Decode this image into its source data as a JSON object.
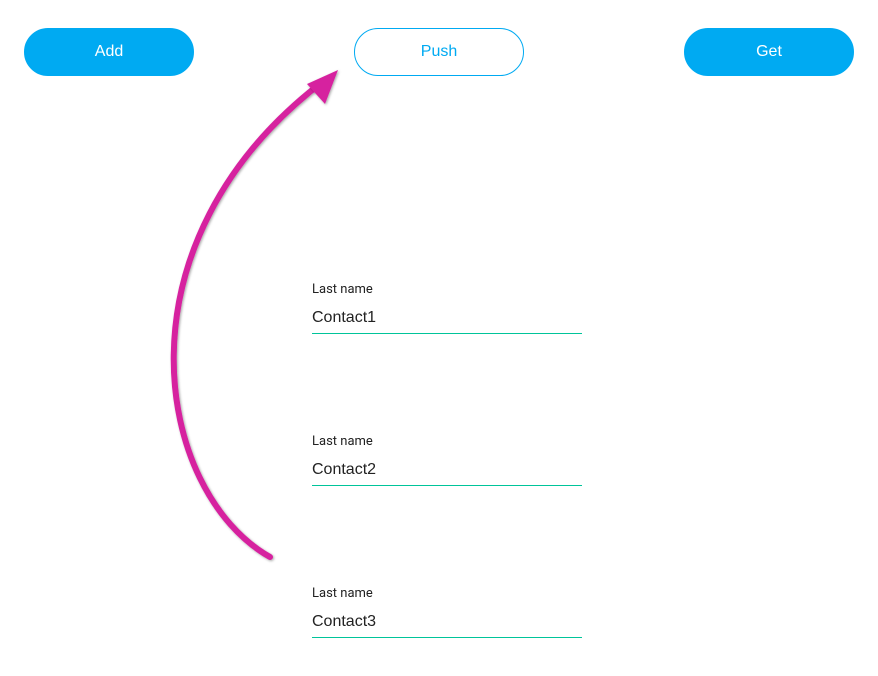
{
  "buttons": {
    "add": "Add",
    "push": "Push",
    "get": "Get"
  },
  "fields": [
    {
      "label": "Last name",
      "value": "Contact1"
    },
    {
      "label": "Last name",
      "value": "Contact2"
    },
    {
      "label": "Last name",
      "value": "Contact3"
    }
  ]
}
